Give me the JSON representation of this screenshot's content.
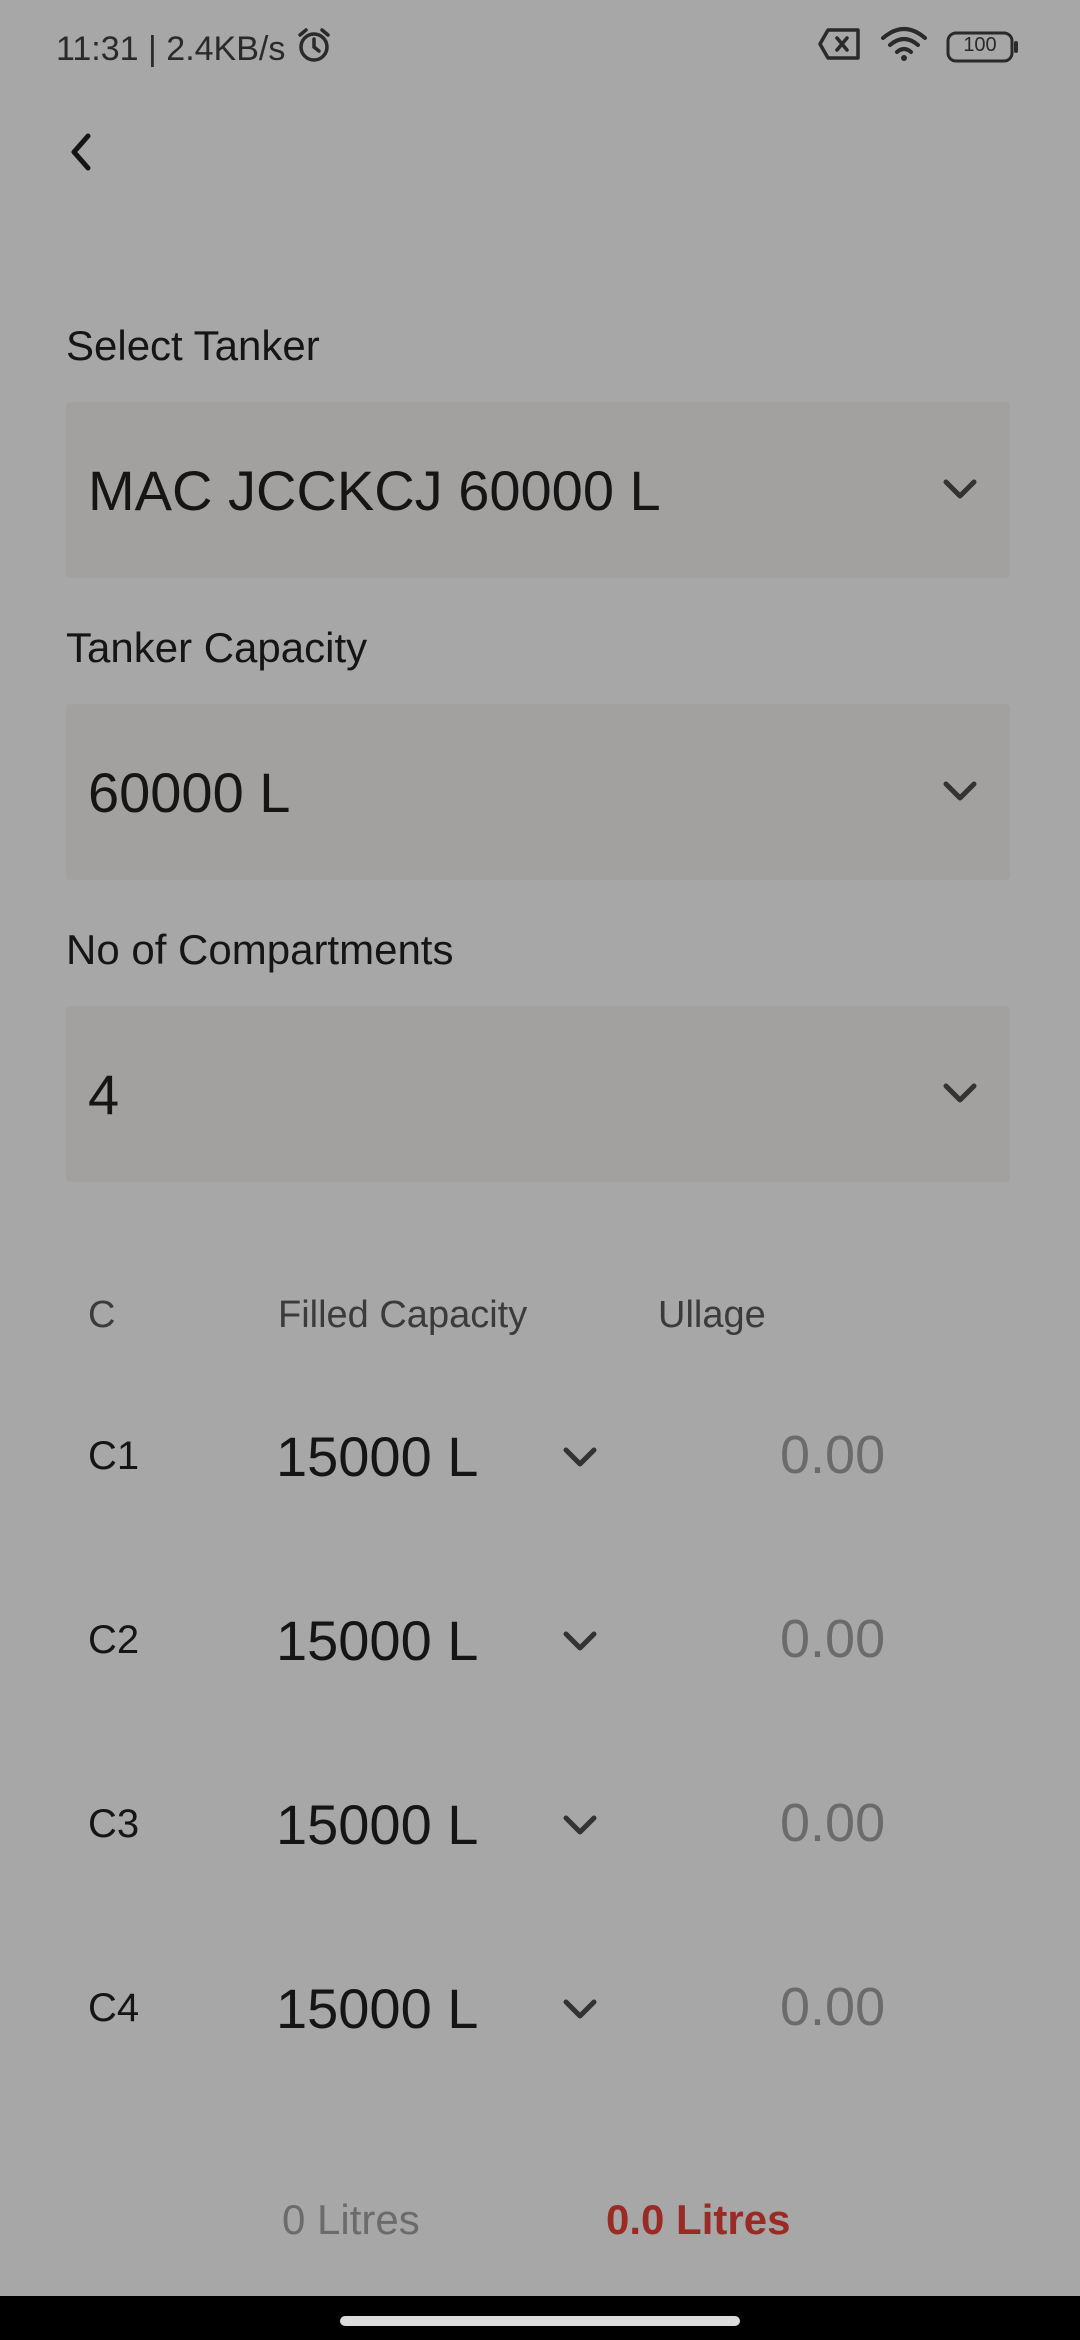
{
  "status_bar": {
    "time_speed": "11:31 | 2.4KB/s",
    "battery": "100",
    "icons": [
      "alarm-icon",
      "sim-off-icon",
      "wifi-icon",
      "battery-icon"
    ]
  },
  "header": {
    "back_icon": "chevron-left-icon"
  },
  "form": {
    "tanker_label": "Select Tanker",
    "tanker_value": "MAC JCCKCJ 60000 L",
    "capacity_label": "Tanker Capacity",
    "capacity_value": "60000 L",
    "compartments_label": "No of Compartments",
    "compartments_value": "4"
  },
  "table": {
    "headers": {
      "col_c": "C",
      "col_filled": "Filled Capacity",
      "col_ullage": "Ullage"
    },
    "rows": [
      {
        "id": "C1",
        "capacity": "15000 L",
        "ullage": "0.00"
      },
      {
        "id": "C2",
        "capacity": "15000 L",
        "ullage": "0.00"
      },
      {
        "id": "C3",
        "capacity": "15000 L",
        "ullage": "0.00"
      },
      {
        "id": "C4",
        "capacity": "15000 L",
        "ullage": "0.00"
      }
    ]
  },
  "footer": {
    "total_filled": "0 Litres",
    "total_ullage": "0.0 Litres"
  },
  "colors": {
    "background": "#a7a7a7",
    "field_bg": "#a2a1a0",
    "accent_red": "#9a2a24"
  }
}
